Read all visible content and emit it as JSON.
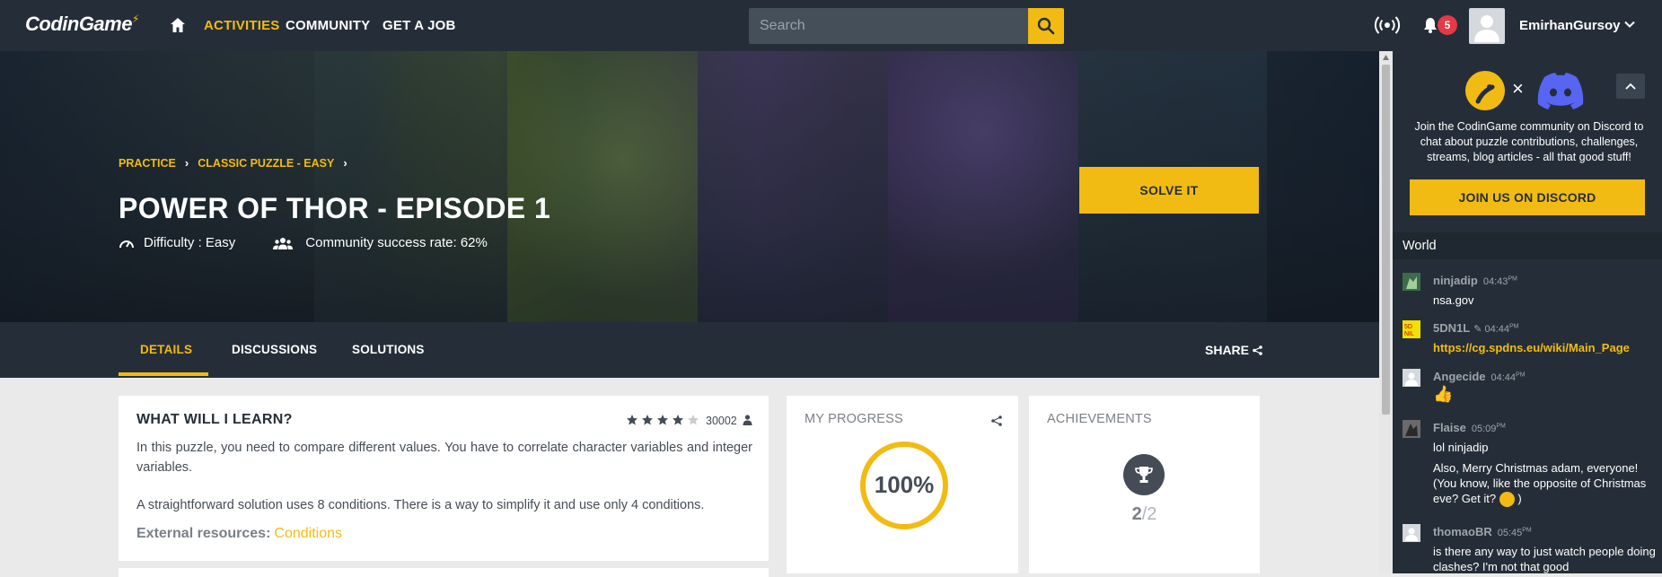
{
  "nav": {
    "logo_text": "CodinGame",
    "links": [
      "ACTIVITIES",
      "COMMUNITY",
      "GET A JOB"
    ],
    "search_placeholder": "Search",
    "notification_count": "5",
    "username": "EmirhanGursoy"
  },
  "hero": {
    "breadcrumbs": [
      "PRACTICE",
      "CLASSIC PUZZLE - EASY"
    ],
    "title": "POWER OF THOR - EPISODE 1",
    "difficulty": "Difficulty : Easy",
    "success_rate": "Community success rate: 62%",
    "solve_label": "SOLVE IT"
  },
  "tabs": {
    "items": [
      "DETAILS",
      "DISCUSSIONS",
      "SOLUTIONS"
    ],
    "share_label": "SHARE"
  },
  "learn": {
    "title": "WHAT WILL I LEARN?",
    "rating_stars": 4,
    "rating_max": 5,
    "rating_count": "30002",
    "para1": "In this puzzle, you need to compare different values. You have to correlate character variables and integer variables.",
    "para2": "A straightforward solution uses 8 conditions. There is a way to simplify it and use only 4 conditions.",
    "external_label": "External resources:",
    "external_link": "Conditions"
  },
  "progress": {
    "title": "MY PROGRESS",
    "percent_label": "100%",
    "percent_value": 100
  },
  "achievements": {
    "title": "ACHIEVEMENTS",
    "earned": "2",
    "total": "/2"
  },
  "sidebar": {
    "discord_text": "Join the CodinGame community on Discord to chat about puzzle contributions, challenges, streams, blog articles - all that good stuff!",
    "discord_button": "JOIN US ON DISCORD",
    "times_symbol": "×",
    "channel": "World",
    "messages": [
      {
        "name": "ninjadip",
        "time": "04:43",
        "ampm": "PM",
        "lines": [
          "nsa.gov"
        ]
      },
      {
        "name": "5DN1L",
        "time": "04:44",
        "ampm": "PM",
        "lines": [
          "https://cg.spdns.eu/wiki/Main_Page"
        ]
      },
      {
        "name": "Angecide",
        "time": "04:44",
        "ampm": "PM",
        "lines": []
      },
      {
        "name": "Flaise",
        "time": "05:09",
        "ampm": "PM",
        "lines": [
          "lol ninjadip",
          "Also, Merry Christmas adam, everyone! (You know, like the opposite of Christmas eve? Get it?",
          ")"
        ]
      },
      {
        "name": "thomaoBR",
        "time": "05:45",
        "ampm": "PM",
        "lines": [
          "is there any way to just watch people doing clashes? I'm not that good"
        ]
      }
    ]
  },
  "colors": {
    "accent": "#f2bb13",
    "dark": "#252e38",
    "badge": "#e53945"
  }
}
